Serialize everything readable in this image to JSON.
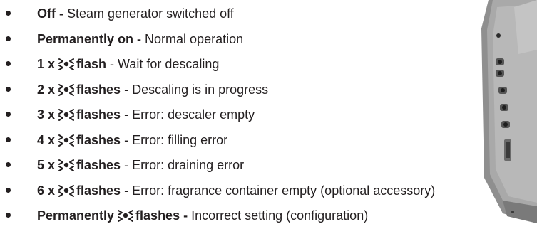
{
  "items": [
    {
      "count": "",
      "lead": "Off -",
      "has_flash_icon": false,
      "flash_word": "",
      "description": " Steam generator switched off"
    },
    {
      "count": "",
      "lead": "Permanently on -",
      "has_flash_icon": false,
      "flash_word": "",
      "description": " Normal operation"
    },
    {
      "count": "1 x",
      "lead": "",
      "has_flash_icon": true,
      "flash_word": "flash",
      "description": " - Wait for descaling"
    },
    {
      "count": "2 x",
      "lead": "",
      "has_flash_icon": true,
      "flash_word": "flashes",
      "description": " - Descaling is in progress"
    },
    {
      "count": "3 x",
      "lead": "",
      "has_flash_icon": true,
      "flash_word": "flashes",
      "description": " - Error: descaler empty"
    },
    {
      "count": "4 x",
      "lead": "",
      "has_flash_icon": true,
      "flash_word": "flashes",
      "description": " - Error: filling error"
    },
    {
      "count": "5 x",
      "lead": "",
      "has_flash_icon": true,
      "flash_word": "flashes",
      "description": " - Error: draining error"
    },
    {
      "count": "6 x",
      "lead": "",
      "has_flash_icon": true,
      "flash_word": "flashes",
      "description": " - Error: fragrance container empty (optional accessory)"
    },
    {
      "count": "Permanently",
      "lead": "",
      "has_flash_icon": true,
      "flash_word": "flashes -",
      "description": " Incorrect setting (configuration)"
    }
  ],
  "colors": {
    "text": "#231f20",
    "device_body": "#9a9a9a",
    "device_dark": "#4a4a4a"
  },
  "icons": {
    "flash": "flashing-led-icon",
    "bullet": "bullet-dot-icon"
  }
}
